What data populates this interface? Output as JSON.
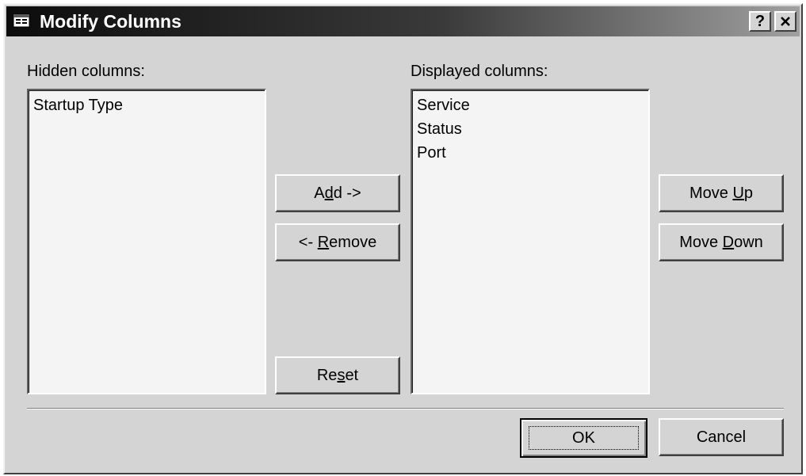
{
  "dialog": {
    "title": "Modify Columns",
    "help_button": "?",
    "close_button": "✕"
  },
  "hidden": {
    "label": "Hidden columns:",
    "items": [
      "Startup Type"
    ]
  },
  "displayed": {
    "label": "Displayed columns:",
    "items": [
      "Service",
      "Status",
      "Port"
    ]
  },
  "buttons": {
    "add": {
      "pre": "A",
      "key": "d",
      "post": "d ->"
    },
    "remove": {
      "pre": "<- ",
      "key": "R",
      "post": "emove"
    },
    "reset": {
      "pre": "Re",
      "key": "s",
      "post": "et"
    },
    "move_up": {
      "pre": "Move ",
      "key": "U",
      "post": "p"
    },
    "move_down": {
      "pre": "Move ",
      "key": "D",
      "post": "own"
    },
    "ok": "OK",
    "cancel": "Cancel"
  },
  "colors": {
    "face": "#d4d4d4",
    "list_bg": "#f4f4f4",
    "title_dark": "#0c0c0c",
    "title_light": "#a0a0a0"
  }
}
